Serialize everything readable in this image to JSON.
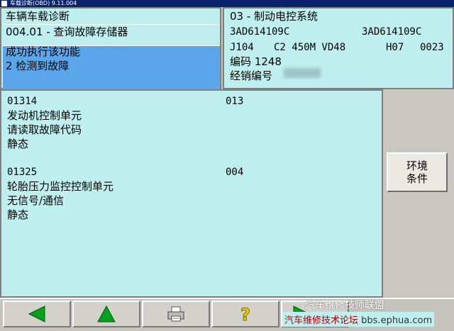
{
  "window": {
    "title": "车载诊断(OBD) 9.11.004"
  },
  "left_header": {
    "title": "车辆车载诊断",
    "function": "004.01 - 查询故障存储器",
    "status_line1": "成功执行该功能",
    "status_line2": "2 检测到故障"
  },
  "right_header": {
    "system": "03 - 制动电控系统",
    "part_no_1": "3AD614109C",
    "part_no_2": "3AD614109C",
    "component": "J104",
    "version": "C2 450M VD48",
    "h_code": "H07",
    "h_num": "0023",
    "coding": "编码 1248",
    "dealer_label": "经销编号"
  },
  "faults": [
    {
      "code": "01314",
      "num": "013",
      "desc": "发动机控制单元",
      "detail": "请读取故障代码",
      "state": "静态"
    },
    {
      "code": "01325",
      "num": "004",
      "desc": "轮胎压力监控控制单元",
      "detail": "无信号/通信",
      "state": "静态"
    }
  ],
  "sidebar": {
    "env_button_line1": "环境",
    "env_button_line2": "条件"
  },
  "toolbar": {
    "icons": [
      "back-arrow-icon",
      "up-arrow-icon",
      "printer-icon",
      "help-icon",
      "forward-arrow-icon"
    ],
    "colors": {
      "arrow": "#00a21a",
      "help": "#e8d400"
    }
  },
  "watermark": {
    "line1": "汽车维修技师联盟",
    "line2": "汽车维修技术论坛",
    "line2_url": "bbs.ephua.com"
  }
}
